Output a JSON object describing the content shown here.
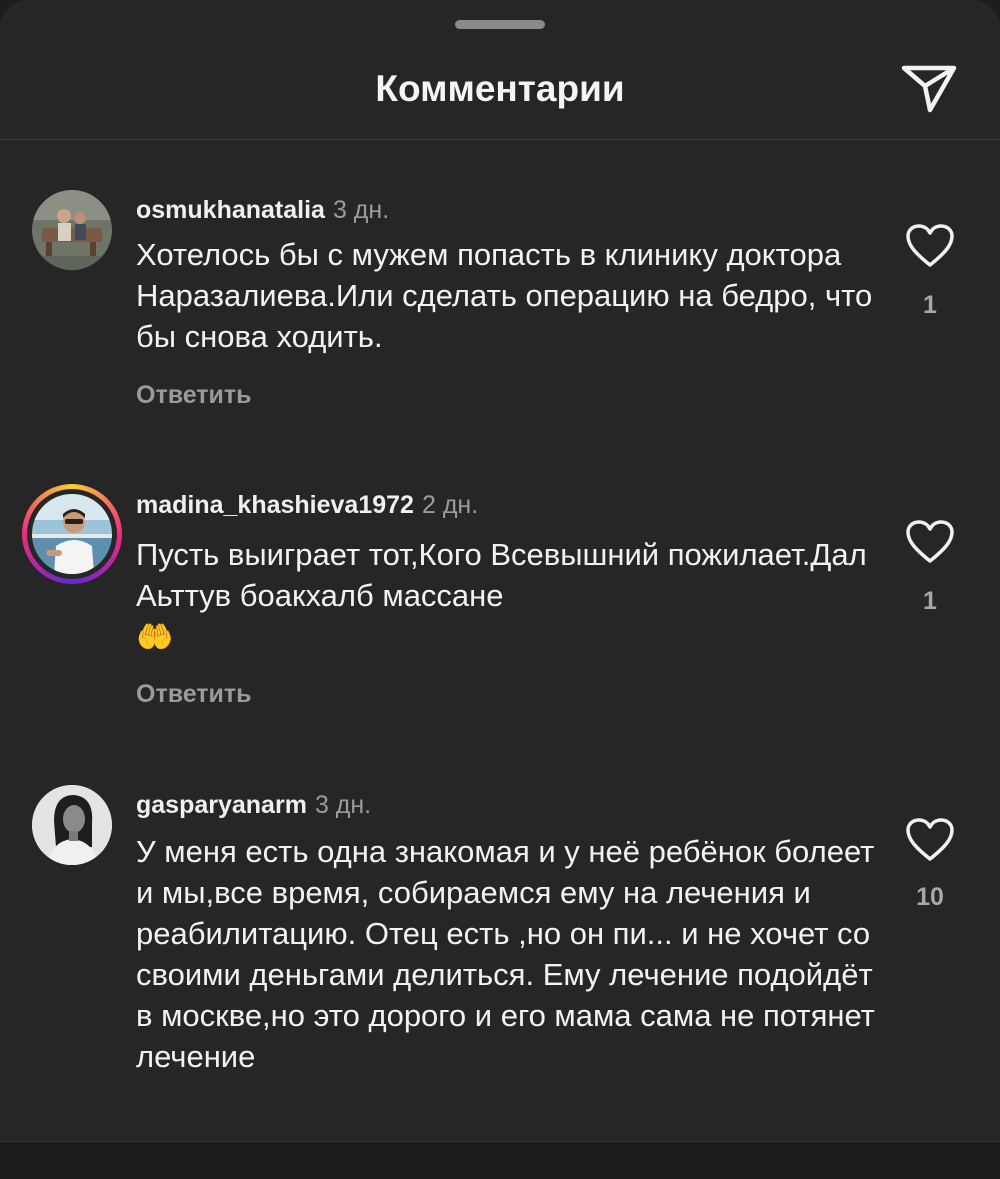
{
  "header": {
    "title": "Комментарии"
  },
  "icons": {
    "send": "send-icon",
    "like": "heart-outline-icon"
  },
  "colors": {
    "background": "#262626",
    "text": "#f2f2f2",
    "secondary": "#9b9b9b"
  },
  "comments": [
    {
      "username": "osmukhanatalia",
      "time": "3 дн.",
      "text": "Хотелось бы с мужем попасть в клинику доктора Наразалиева.Или сделать операцию на бедро, что бы снова ходить.",
      "reply_label": "Ответить",
      "likes": "1"
    },
    {
      "username": "madina_khashieva1972",
      "time": "2 дн.",
      "text": "Пусть выиграет тот,Кого Всевышний пожилает.Дал Аьттув боакхалб массане",
      "emoji": "🤲",
      "reply_label": "Ответить",
      "likes": "1"
    },
    {
      "username": "gasparyanarm",
      "time": "3 дн.",
      "text": "У меня есть одна знакомая и у неё ребёнок болеет и мы,все время, собираемся ему на лечения и реабилитацию. Отец есть ,но он пи... и не хочет со своими  деньгами делиться. Ему лечение подойдёт в москве,но это дорого и его мама сама не потянет лечение",
      "likes": "10"
    }
  ]
}
